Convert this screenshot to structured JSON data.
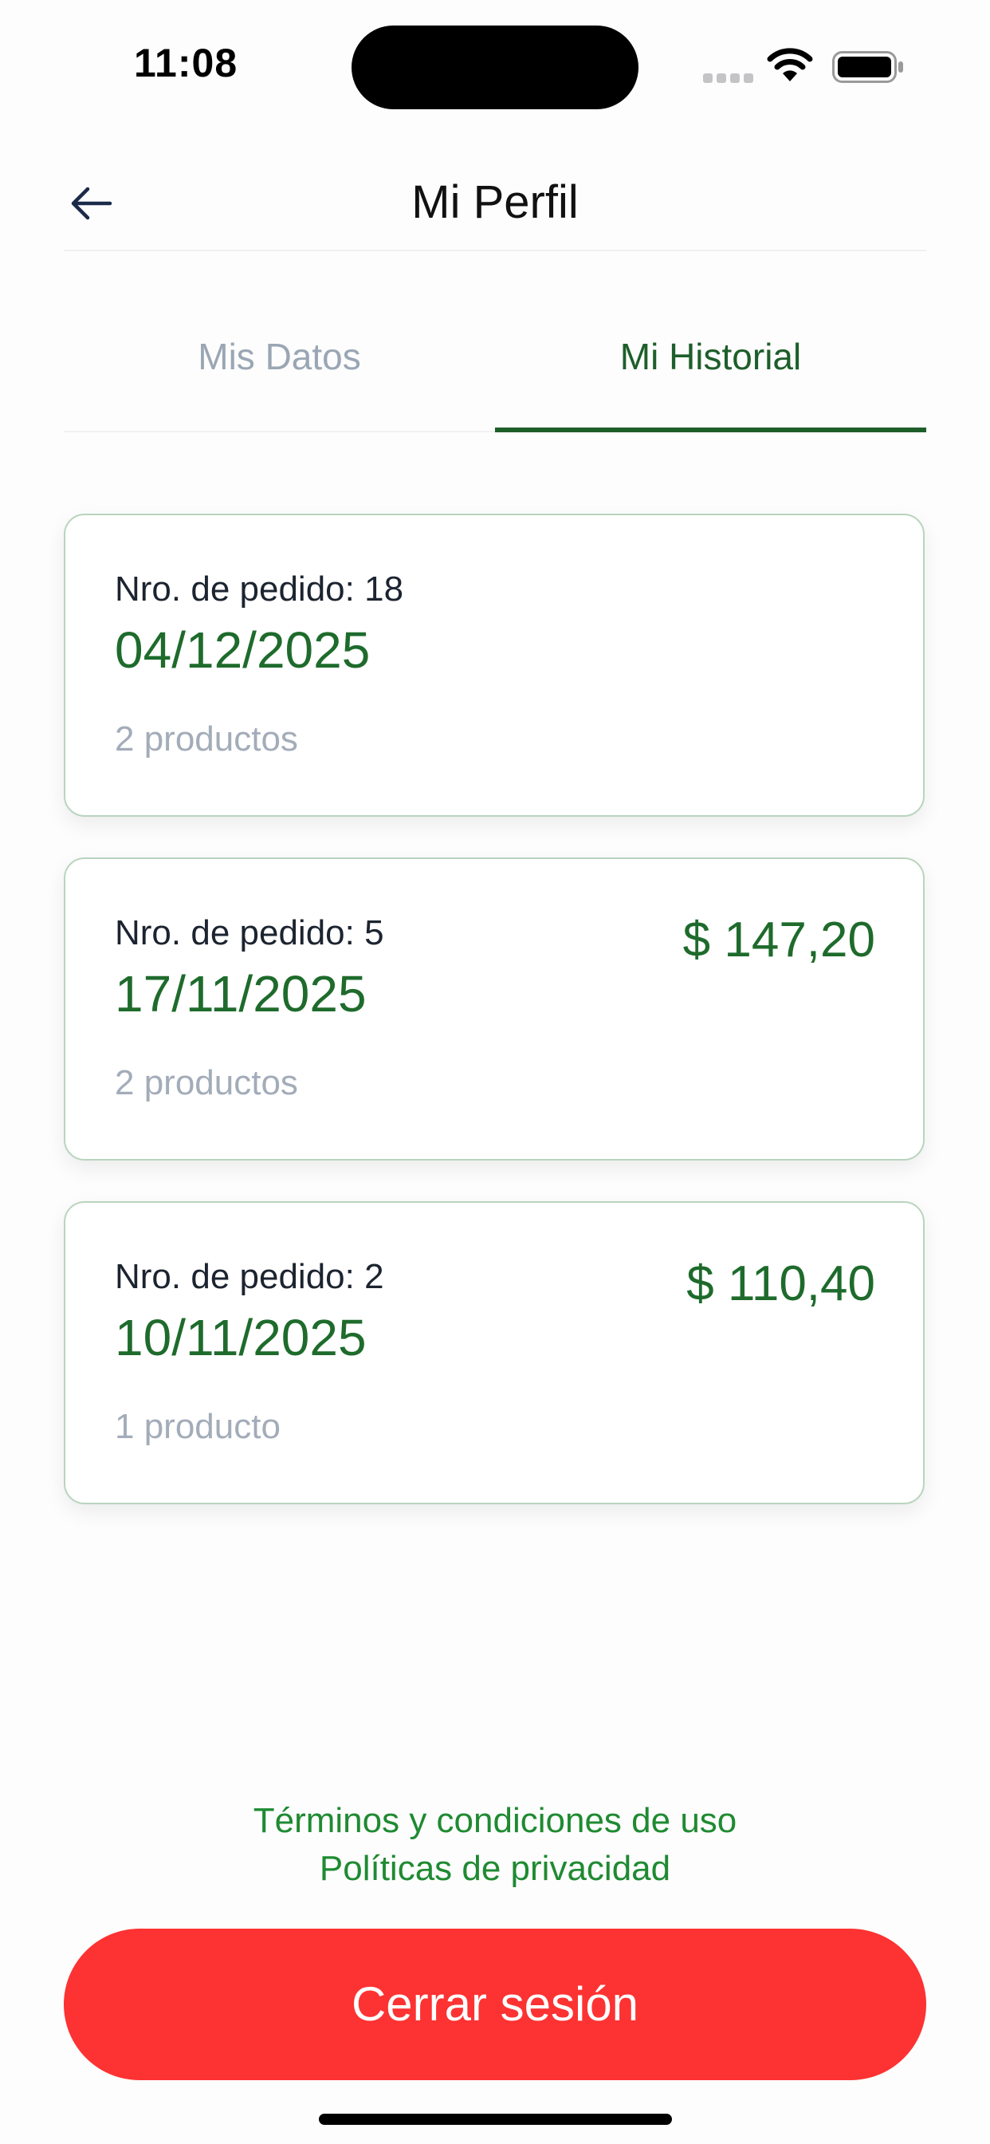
{
  "status_bar": {
    "time": "11:08"
  },
  "header": {
    "title": "Mi Perfil",
    "back_icon": "arrow-left-icon"
  },
  "tabs": [
    {
      "label": "Mis Datos",
      "active": false
    },
    {
      "label": "Mi Historial",
      "active": true
    }
  ],
  "orders": [
    {
      "number_label": "Nro. de pedido: 18",
      "date": "04/12/2025",
      "count": "2 productos",
      "total": ""
    },
    {
      "number_label": "Nro. de pedido: 5",
      "date": "17/11/2025",
      "count": "2 productos",
      "total": "$ 147,20"
    },
    {
      "number_label": "Nro. de pedido: 2",
      "date": "10/11/2025",
      "count": "1 producto",
      "total": "$ 110,40"
    }
  ],
  "footer": {
    "terms_link": "Términos y condiciones de uso",
    "privacy_link": "Políticas de privacidad",
    "logout_label": "Cerrar sesión"
  },
  "colors": {
    "brand_green": "#1e6b2c",
    "link_green": "#1f8a32",
    "logout_red": "#fd3232",
    "muted_gray": "#a3acb9"
  }
}
